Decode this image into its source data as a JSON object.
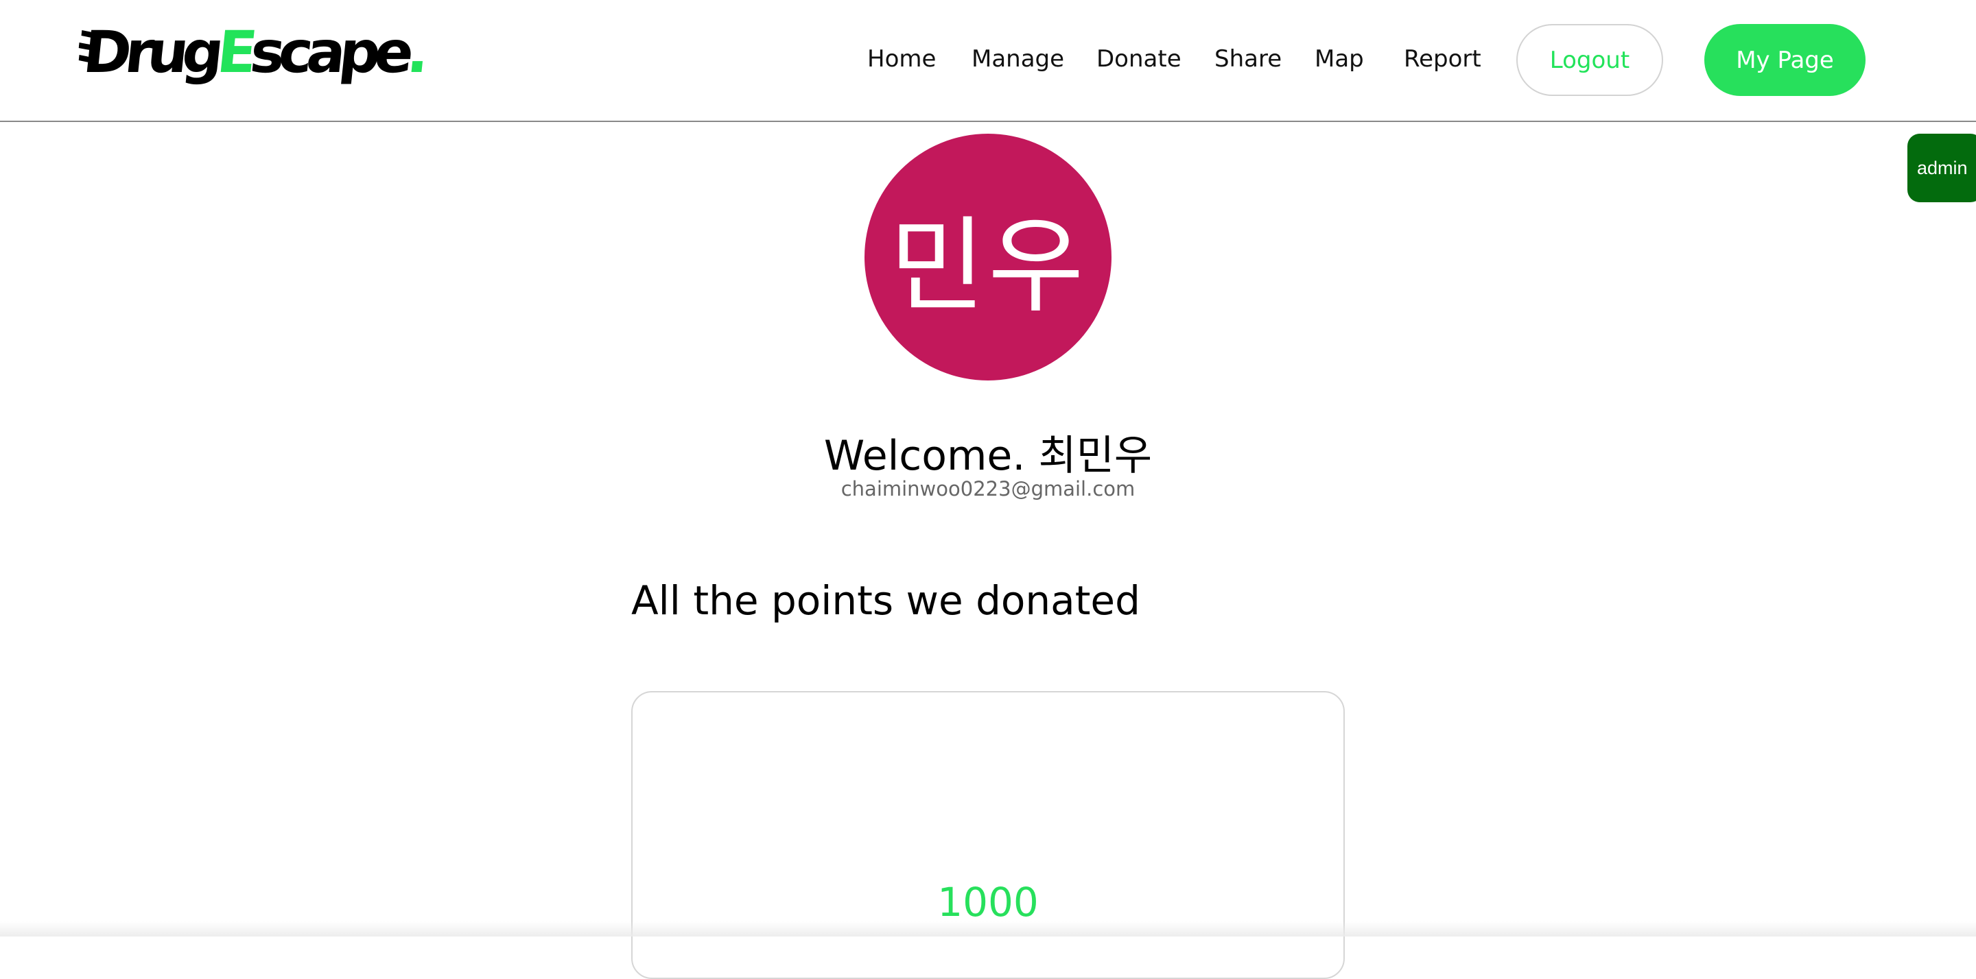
{
  "header": {
    "logo": {
      "part1": "Drug",
      "part2": "E",
      "part3": "scape",
      "part4": "."
    },
    "nav": {
      "home": "Home",
      "manage": "Manage",
      "donate": "Donate",
      "share": "Share",
      "map": "Map",
      "report": "Report"
    },
    "logout_label": "Logout",
    "mypage_label": "My Page"
  },
  "admin_tab": {
    "label": "admin"
  },
  "profile": {
    "avatar_text": "민우",
    "welcome": "Welcome. 최민우",
    "email": "chaiminwoo0223@gmail.com"
  },
  "donations": {
    "title": "All the points we donated",
    "points": "1000"
  },
  "colors": {
    "accent_green": "#27e05c",
    "admin_green": "#036b0d",
    "avatar_bg": "#c2185b"
  }
}
